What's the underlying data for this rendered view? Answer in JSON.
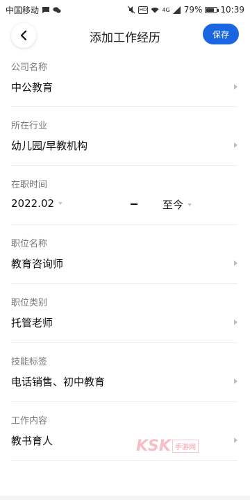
{
  "status_bar": {
    "carrier": "中国移动",
    "hd": "HD",
    "network": "4G",
    "battery_percent": "79%",
    "battery_level": 0.79,
    "time": "10:39"
  },
  "header": {
    "title": "添加工作经历",
    "save_label": "保存"
  },
  "fields": {
    "company": {
      "label": "公司名称",
      "value": "中公教育"
    },
    "industry": {
      "label": "所在行业",
      "value": "幼儿园/早教机构"
    },
    "period": {
      "label": "在职时间",
      "start": "2022.02",
      "end": "至今"
    },
    "position": {
      "label": "职位名称",
      "value": "教育咨询师"
    },
    "category": {
      "label": "职位类别",
      "value": "托管老师"
    },
    "skills": {
      "label": "技能标签",
      "value": "电话销售、初中教育"
    },
    "content": {
      "label": "工作内容",
      "value": "教书育人"
    }
  },
  "watermark": {
    "main": "KSK",
    "sub": "手游网"
  }
}
